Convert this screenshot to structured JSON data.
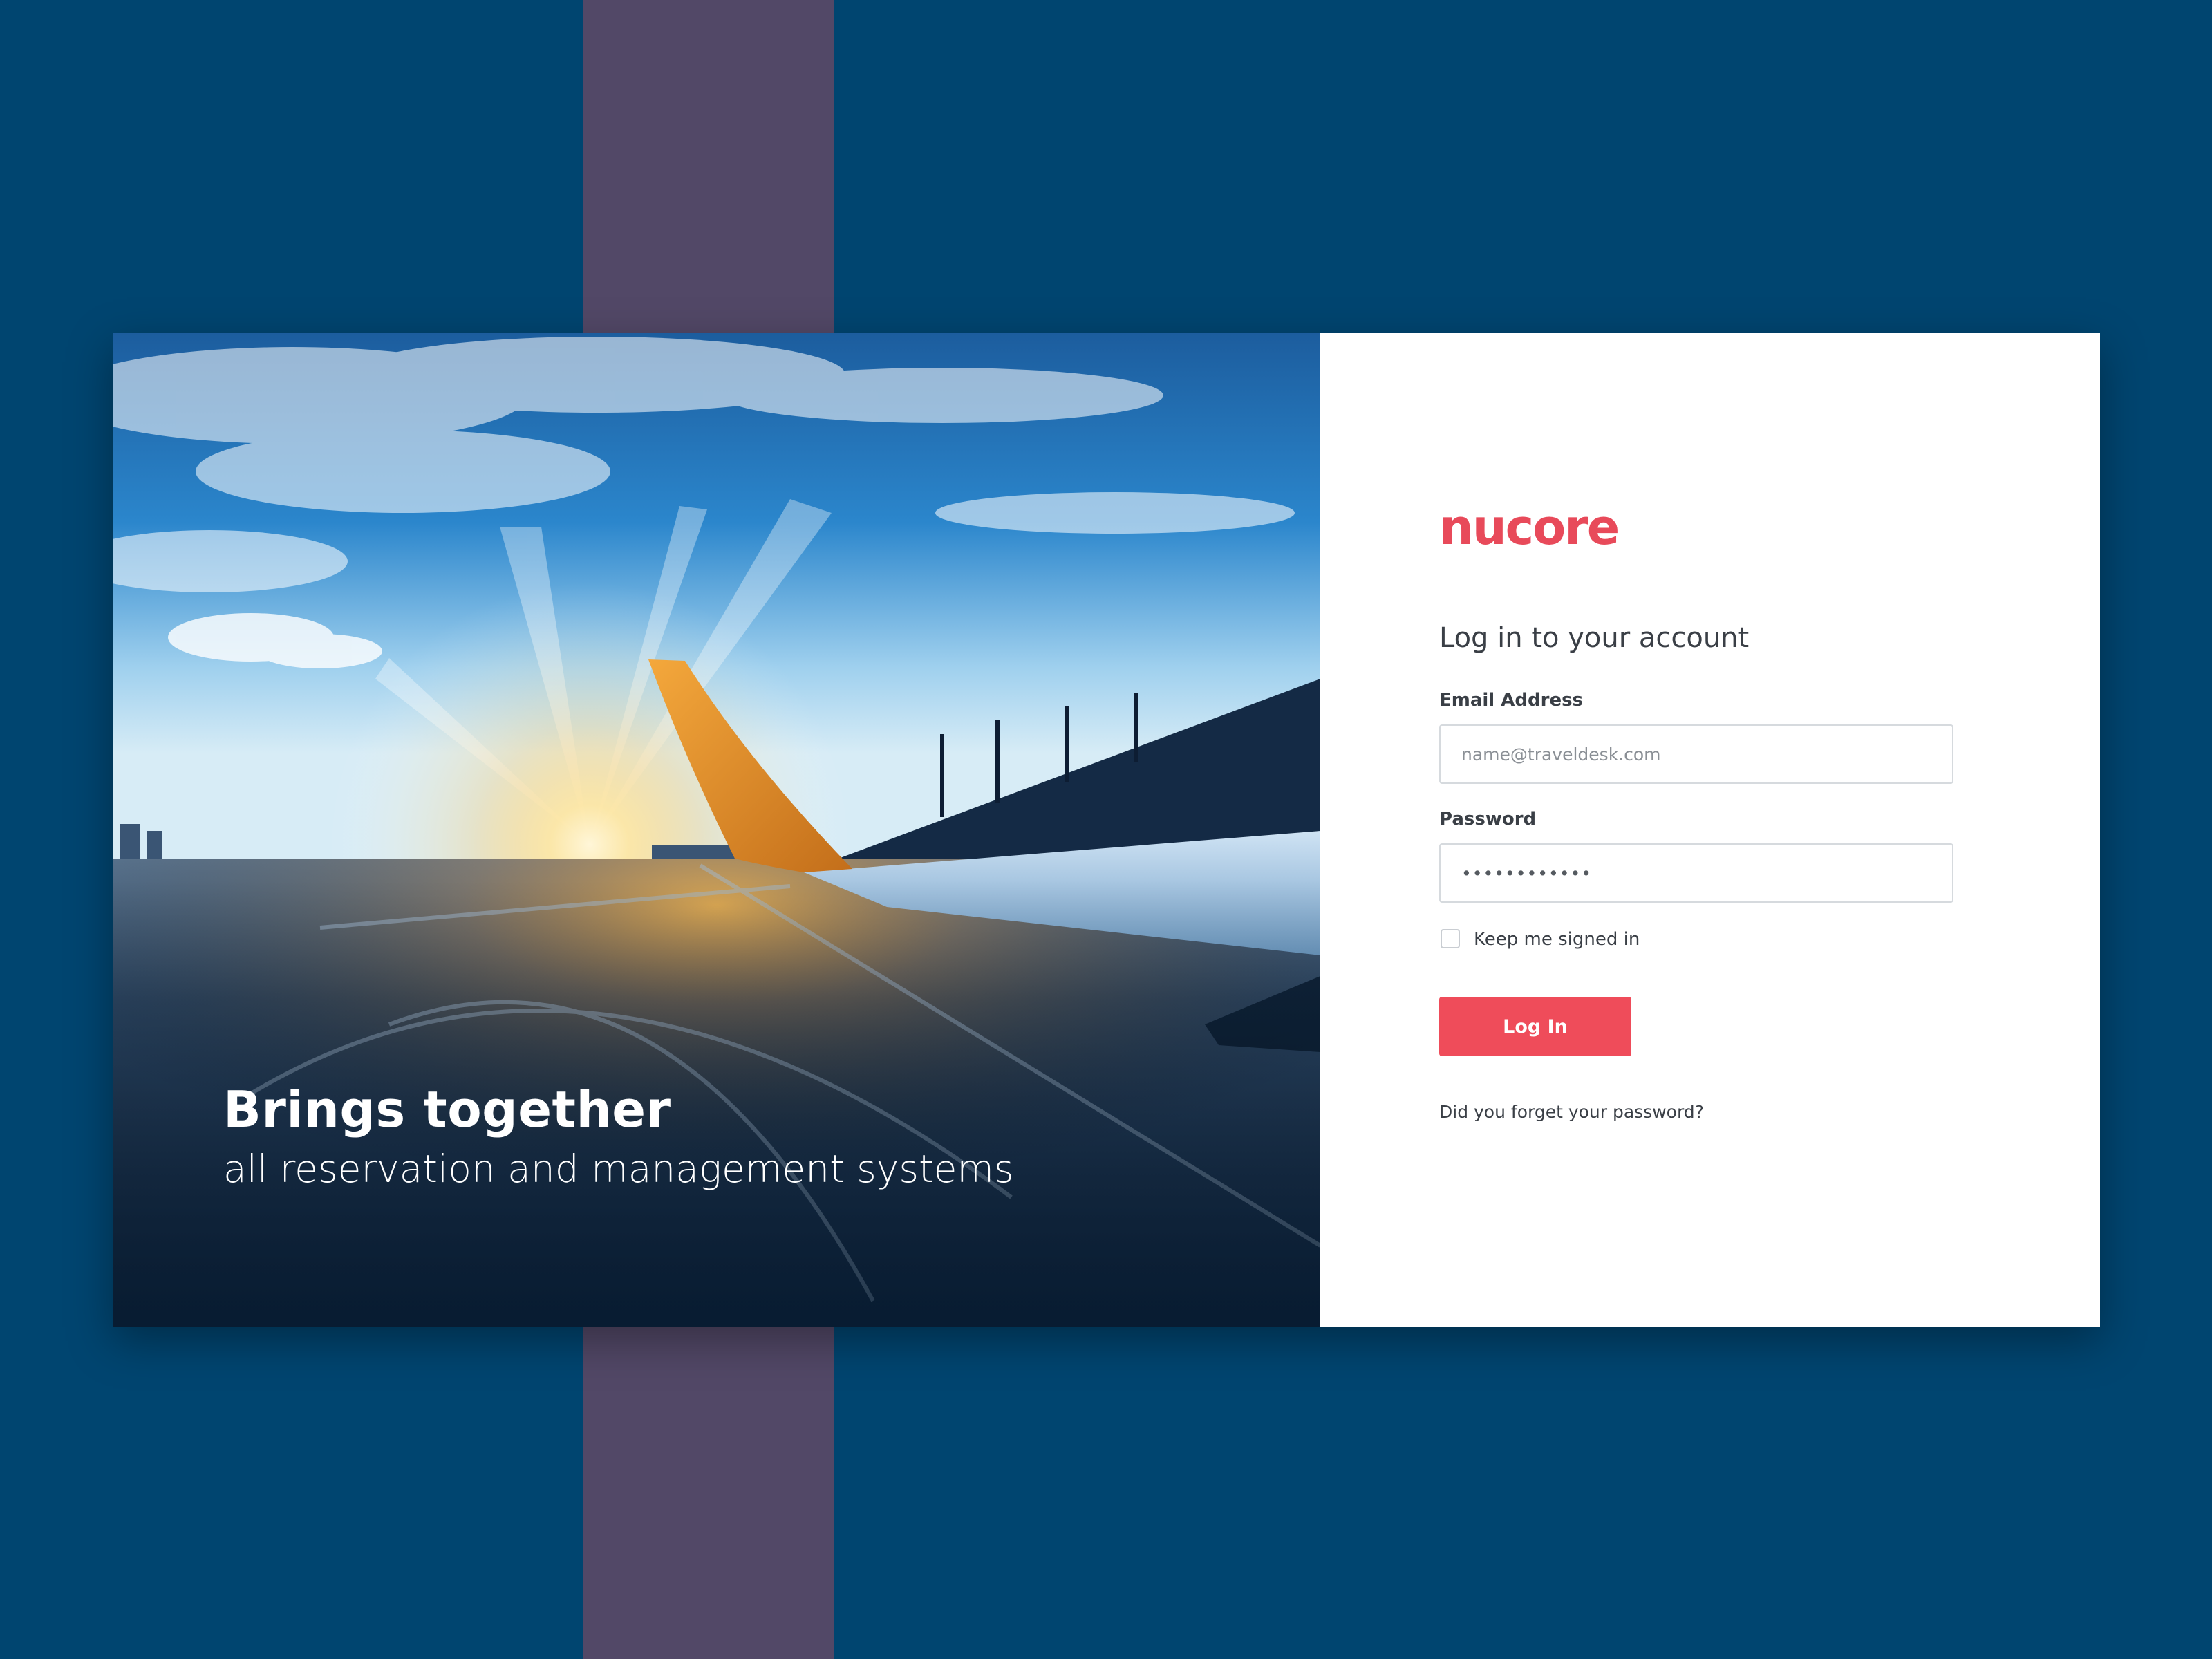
{
  "colors": {
    "background": "#004570",
    "stripe": "#524867",
    "brand": "#e84a5a",
    "button": "#ef4c5a",
    "text": "#3a3f46"
  },
  "hero": {
    "title": "Brings together",
    "subtitle": "all reservation and management systems",
    "image_subject": "airplane wing on runway at sunrise"
  },
  "login": {
    "logo": "nucore",
    "heading": "Log in to your account",
    "email": {
      "label": "Email Address",
      "placeholder": "name@traveldesk.com",
      "value": ""
    },
    "password": {
      "label": "Password",
      "value": "••••••••••••"
    },
    "keep_signed_in": {
      "label": "Keep me signed in",
      "checked": false
    },
    "login_button": "Log In",
    "forgot_link": "Did you forget your password?"
  }
}
